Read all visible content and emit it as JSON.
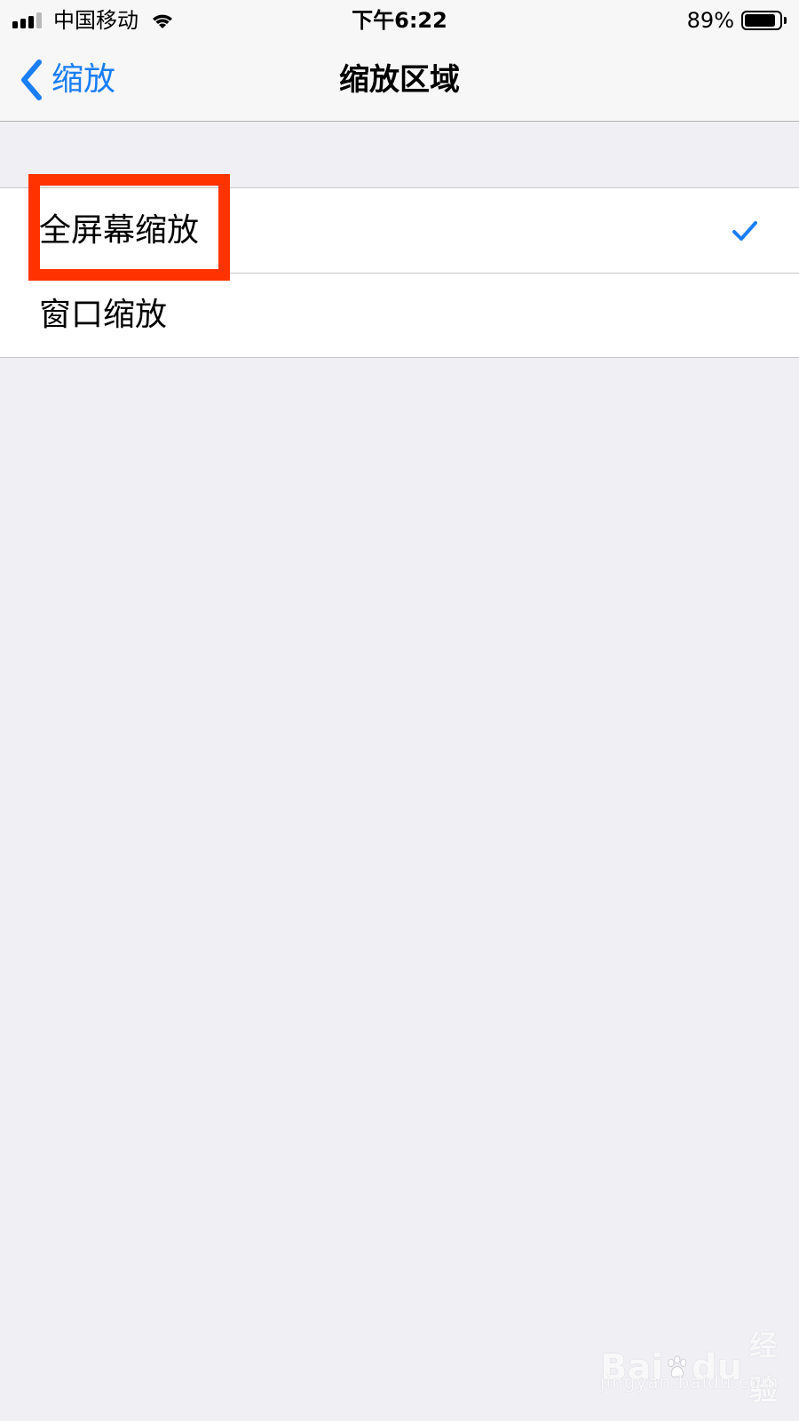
{
  "status_bar": {
    "carrier": "中国移动",
    "time": "下午6:22",
    "battery_percent": "89%",
    "battery_level": 0.89,
    "icons": [
      "signal-icon",
      "wifi-icon",
      "battery-icon"
    ]
  },
  "nav": {
    "back_label": "缩放",
    "title": "缩放区域",
    "accent_color": "#1a7ef5"
  },
  "options": [
    {
      "label": "全屏幕缩放",
      "selected": true
    },
    {
      "label": "窗口缩放",
      "selected": false
    }
  ],
  "annotation": {
    "highlight_color": "#ff3300"
  },
  "watermark": {
    "logo_left": "Bai",
    "logo_right": "du",
    "logo_cn": "经验",
    "sub": "jingyan.baidu.com"
  }
}
